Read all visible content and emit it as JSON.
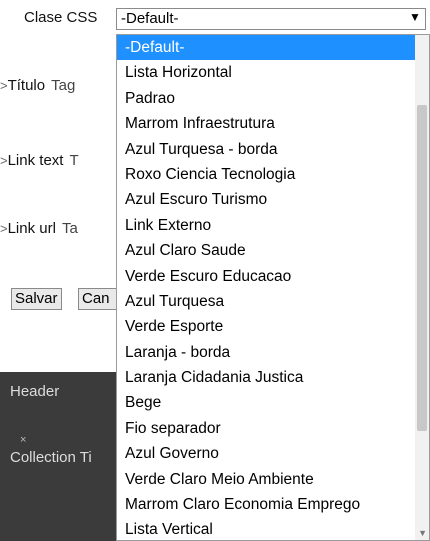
{
  "form": {
    "css_class_label": "Clase CSS",
    "css_class_value": "-Default-",
    "rows": [
      {
        "label": "Título",
        "hint": "Tag"
      },
      {
        "label": "Link text",
        "hint": "T"
      },
      {
        "label": "Link url",
        "hint": "Ta"
      }
    ],
    "save_label": "Salvar",
    "cancel_label": "Can"
  },
  "dropdown": {
    "selected_index": 0,
    "options": [
      "-Default-",
      "Lista Horizontal",
      "Padrao",
      "Marrom Infraestrutura",
      "Azul Turquesa - borda",
      "Roxo Ciencia Tecnologia",
      "Azul Escuro Turismo",
      "Link Externo",
      "Azul Claro Saude",
      "Verde Escuro Educacao",
      "Azul Turquesa",
      "Verde Esporte",
      "Laranja - borda",
      "Laranja Cidadania Justica",
      "Bege",
      "Fio separador",
      "Azul Governo",
      "Verde Claro Meio Ambiente",
      "Marrom Claro Economia Emprego",
      "Lista Vertical"
    ]
  },
  "panel": {
    "header_label": "Header",
    "collection_label": "Collection Ti"
  },
  "colors": {
    "selection": "#1e90ff",
    "panel_bg": "#3b3b3b"
  }
}
